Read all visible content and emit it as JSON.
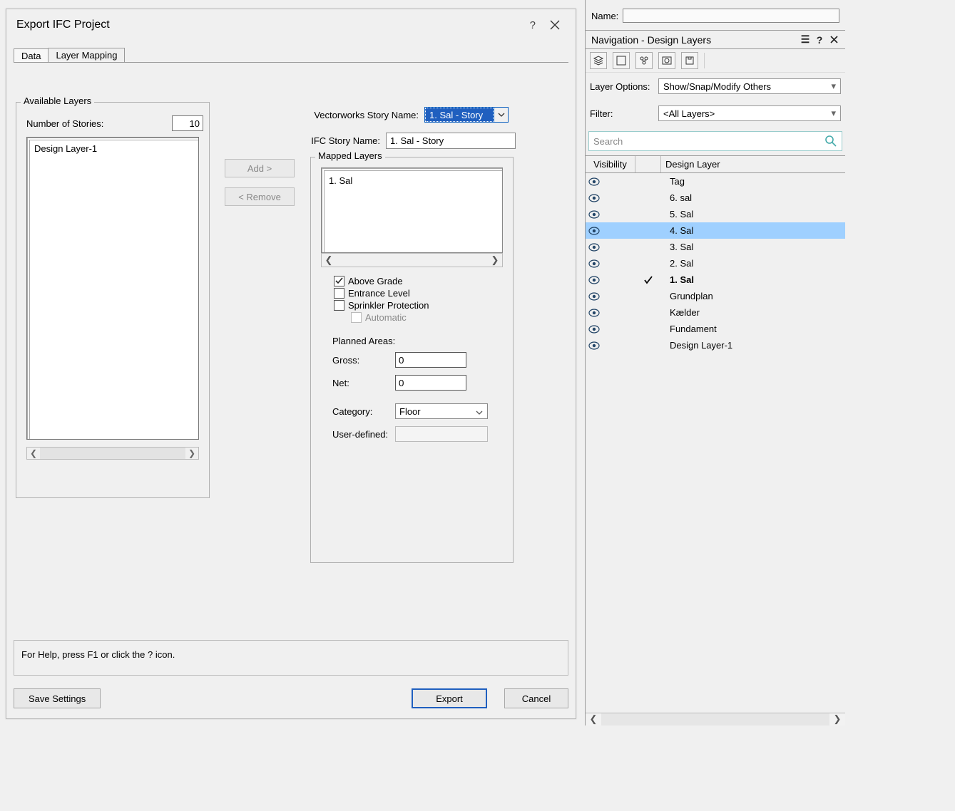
{
  "dialog": {
    "title": "Export IFC Project",
    "help_glyph": "?",
    "tabs": {
      "data": "Data",
      "layer_mapping": "Layer Mapping"
    },
    "available": {
      "legend": "Available Layers",
      "number_label": "Number of Stories:",
      "number_value": "10",
      "items": [
        "Design Layer-1"
      ]
    },
    "buttons": {
      "add": "Add >",
      "remove": "< Remove"
    },
    "story": {
      "vw_label": "Vectorworks Story Name:",
      "vw_value": "1. Sal - Story",
      "ifc_label": "IFC Story Name:",
      "ifc_value": "1. Sal - Story"
    },
    "mapped": {
      "legend": "Mapped Layers",
      "items": [
        "1. Sal"
      ],
      "checks": {
        "above_grade": "Above Grade",
        "entrance_level": "Entrance Level",
        "sprinkler": "Sprinkler Protection",
        "automatic": "Automatic"
      },
      "planned_areas": "Planned Areas:",
      "gross_label": "Gross:",
      "gross_value": "0",
      "net_label": "Net:",
      "net_value": "0",
      "category_label": "Category:",
      "category_value": "Floor",
      "user_defined_label": "User-defined:"
    },
    "help_text": "For Help, press F1 or click the ? icon.",
    "footer": {
      "save": "Save Settings",
      "export": "Export",
      "cancel": "Cancel"
    }
  },
  "side": {
    "name_label": "Name:",
    "name_value": "",
    "palette_title": "Navigation - Design Layers",
    "layer_options_label": "Layer Options:",
    "layer_options_value": "Show/Snap/Modify Others",
    "filter_label": "Filter:",
    "filter_value": "<All Layers>",
    "search_placeholder": "Search",
    "col_visibility": "Visibility",
    "col_design_layer": "Design Layer",
    "rows": [
      {
        "name": "Tag",
        "active": false,
        "hl": false
      },
      {
        "name": "6. sal",
        "active": false,
        "hl": false
      },
      {
        "name": "5. Sal",
        "active": false,
        "hl": false
      },
      {
        "name": "4. Sal",
        "active": false,
        "hl": true
      },
      {
        "name": "3. Sal",
        "active": false,
        "hl": false
      },
      {
        "name": "2. Sal",
        "active": false,
        "hl": false
      },
      {
        "name": "1. Sal",
        "active": true,
        "hl": false
      },
      {
        "name": "Grundplan",
        "active": false,
        "hl": false
      },
      {
        "name": "Kælder",
        "active": false,
        "hl": false
      },
      {
        "name": "Fundament",
        "active": false,
        "hl": false
      },
      {
        "name": "Design Layer-1",
        "active": false,
        "hl": false
      }
    ]
  }
}
